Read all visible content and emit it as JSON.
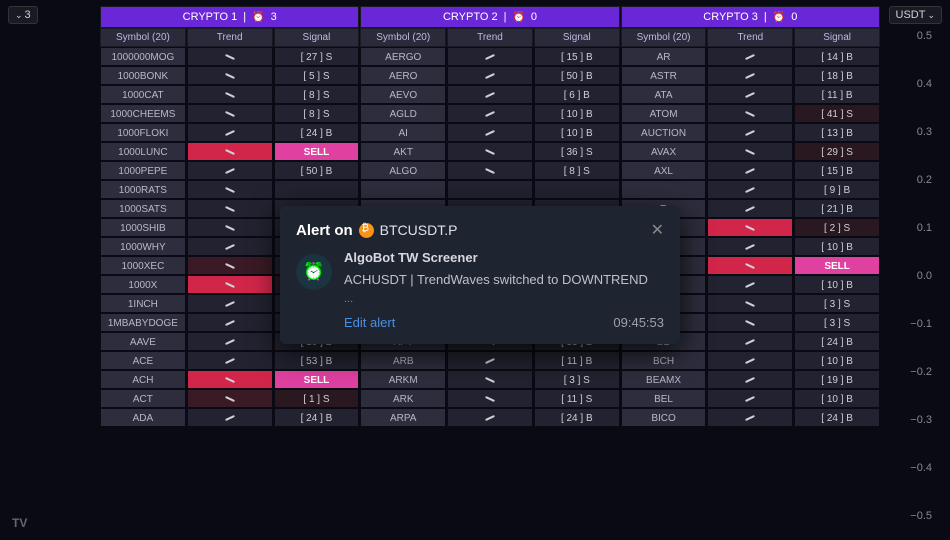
{
  "leftCtrl": "3",
  "rightCtrl": "USDT",
  "groups": [
    {
      "name": "CRYPTO 1",
      "alarm": "3"
    },
    {
      "name": "CRYPTO 2",
      "alarm": "0"
    },
    {
      "name": "CRYPTO 3",
      "alarm": "0"
    }
  ],
  "subheaders": [
    "Symbol (20)",
    "Trend",
    "Signal"
  ],
  "yaxis": [
    "0.5",
    "0.4",
    "0.3",
    "0.2",
    "0.1",
    "0.0",
    "−0.1",
    "−0.2",
    "−0.3",
    "−0.4",
    "−0.5"
  ],
  "alert": {
    "title": "Alert on",
    "symbol": "BTCUSDT.P",
    "source": "AlgoBot TW Screener",
    "message": "ACHUSDT | TrendWaves switched to DOWNTREND",
    "edit": "Edit alert",
    "time": "09:45:53"
  },
  "rows": [
    {
      "g1": {
        "sym": "1000000MOG",
        "t": "down",
        "s": "[ 27 ] S"
      },
      "g2": {
        "sym": "AERGO",
        "t": "up",
        "s": "[ 15 ] B"
      },
      "g3": {
        "sym": "AR",
        "t": "up",
        "s": "[ 14 ] B"
      }
    },
    {
      "g1": {
        "sym": "1000BONK",
        "t": "down",
        "s": "[ 5 ] S"
      },
      "g2": {
        "sym": "AERO",
        "t": "up",
        "s": "[ 50 ] B"
      },
      "g3": {
        "sym": "ASTR",
        "t": "up",
        "s": "[ 18 ] B"
      }
    },
    {
      "g1": {
        "sym": "1000CAT",
        "t": "down",
        "s": "[ 8 ] S"
      },
      "g2": {
        "sym": "AEVO",
        "t": "up",
        "s": "[ 6 ] B"
      },
      "g3": {
        "sym": "ATA",
        "t": "up",
        "s": "[ 11 ] B"
      }
    },
    {
      "g1": {
        "sym": "1000CHEEMS",
        "t": "down",
        "s": "[ 8 ] S"
      },
      "g2": {
        "sym": "AGLD",
        "t": "up",
        "s": "[ 10 ] B"
      },
      "g3": {
        "sym": "ATOM",
        "t": "down",
        "s": "[ 41 ] S",
        "sd": 1
      }
    },
    {
      "g1": {
        "sym": "1000FLOKI",
        "t": "up",
        "s": "[ 24 ] B"
      },
      "g2": {
        "sym": "AI",
        "t": "up",
        "s": "[ 10 ] B"
      },
      "g3": {
        "sym": "AUCTION",
        "t": "up",
        "s": "[ 13 ] B"
      }
    },
    {
      "g1": {
        "sym": "1000LUNC",
        "t": "down",
        "tr": 1,
        "s": "SELL",
        "sell": 1
      },
      "g2": {
        "sym": "AKT",
        "t": "down",
        "s": "[ 36 ] S"
      },
      "g3": {
        "sym": "AVAX",
        "t": "down",
        "s": "[ 29 ] S",
        "sd": 1
      }
    },
    {
      "g1": {
        "sym": "1000PEPE",
        "t": "up",
        "s": "[ 50 ] B"
      },
      "g2": {
        "sym": "ALGO",
        "t": "down",
        "s": "[ 8 ] S"
      },
      "g3": {
        "sym": "AXL",
        "t": "up",
        "s": "[ 15 ] B"
      }
    },
    {
      "g1": {
        "sym": "1000RATS",
        "t": "down",
        "s": ""
      },
      "g2": {
        "sym": "",
        "t": "",
        "s": ""
      },
      "g3": {
        "sym": "",
        "t": "up",
        "s": "[ 9 ] B"
      }
    },
    {
      "g1": {
        "sym": "1000SATS",
        "t": "down",
        "s": ""
      },
      "g2": {
        "sym": "",
        "t": "",
        "s": ""
      },
      "g3": {
        "sym": "R",
        "t": "up",
        "s": "[ 21 ] B"
      }
    },
    {
      "g1": {
        "sym": "1000SHIB",
        "t": "down",
        "s": ""
      },
      "g2": {
        "sym": "",
        "t": "",
        "s": ""
      },
      "g3": {
        "sym": "",
        "t": "down",
        "tr": 1,
        "s": "[ 2 ] S",
        "sd": 1
      }
    },
    {
      "g1": {
        "sym": "1000WHY",
        "t": "up",
        "s": ""
      },
      "g2": {
        "sym": "",
        "t": "",
        "s": ""
      },
      "g3": {
        "sym": "",
        "t": "up",
        "s": "[ 10 ] B"
      }
    },
    {
      "g1": {
        "sym": "1000XEC",
        "t": "down",
        "td": 1,
        "s": ""
      },
      "g2": {
        "sym": "",
        "t": "",
        "s": ""
      },
      "g3": {
        "sym": "A",
        "t": "down",
        "tr": 1,
        "s": "SELL",
        "sell": 1
      }
    },
    {
      "g1": {
        "sym": "1000X",
        "t": "down",
        "tr": 1,
        "s": "",
        "sd": 1
      },
      "g2": {
        "sym": "",
        "t": "",
        "s": ""
      },
      "g3": {
        "sym": "",
        "t": "up",
        "s": "[ 10 ] B"
      }
    },
    {
      "g1": {
        "sym": "1INCH",
        "t": "up",
        "s": ""
      },
      "g2": {
        "sym": "",
        "t": "",
        "s": ""
      },
      "g3": {
        "sym": "",
        "t": "down",
        "s": "[ 3 ] S"
      }
    },
    {
      "g1": {
        "sym": "1MBABYDOGE",
        "t": "up",
        "s": ""
      },
      "g2": {
        "sym": "",
        "t": "",
        "s": ""
      },
      "g3": {
        "sym": "",
        "t": "down",
        "s": "[ 3 ] S"
      }
    },
    {
      "g1": {
        "sym": "AAVE",
        "t": "up",
        "s": "[ 10 ] B"
      },
      "g2": {
        "sym": "APT",
        "t": "down",
        "s": "[ 53 ] B"
      },
      "g3": {
        "sym": "BB",
        "t": "up",
        "s": "[ 24 ] B"
      }
    },
    {
      "g1": {
        "sym": "ACE",
        "t": "up",
        "s": "[ 53 ] B"
      },
      "g2": {
        "sym": "ARB",
        "t": "up",
        "s": "[ 11 ] B"
      },
      "g3": {
        "sym": "BCH",
        "t": "up",
        "s": "[ 10 ] B"
      }
    },
    {
      "g1": {
        "sym": "ACH",
        "t": "down",
        "tr": 1,
        "s": "SELL",
        "sell": 1
      },
      "g2": {
        "sym": "ARKM",
        "t": "down",
        "s": "[ 3 ] S"
      },
      "g3": {
        "sym": "BEAMX",
        "t": "up",
        "s": "[ 19 ] B"
      }
    },
    {
      "g1": {
        "sym": "ACT",
        "t": "down",
        "td": 1,
        "s": "[ 1 ] S",
        "sd": 1
      },
      "g2": {
        "sym": "ARK",
        "t": "down",
        "s": "[ 11 ] S"
      },
      "g3": {
        "sym": "BEL",
        "t": "up",
        "s": "[ 10 ] B"
      }
    },
    {
      "g1": {
        "sym": "ADA",
        "t": "up",
        "s": "[ 24 ] B"
      },
      "g2": {
        "sym": "ARPA",
        "t": "up",
        "s": "[ 24 ] B"
      },
      "g3": {
        "sym": "BICO",
        "t": "up",
        "s": "[ 24 ] B"
      }
    }
  ],
  "logo": "TV"
}
